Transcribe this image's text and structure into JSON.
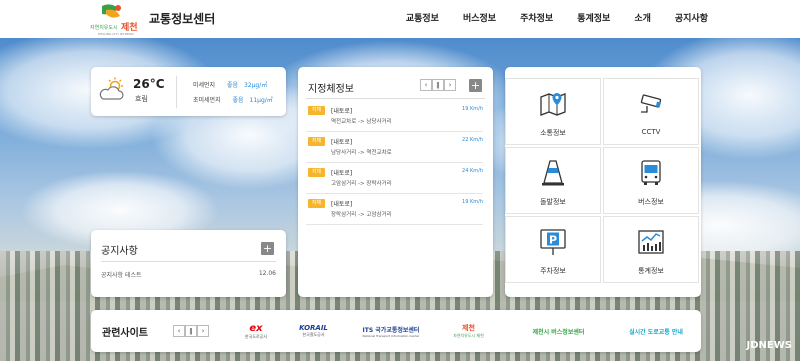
{
  "header": {
    "logo_alt": "자연치유도시 제천",
    "title": "교통정보센터",
    "nav": [
      "교통정보",
      "버스정보",
      "주차정보",
      "통계정보",
      "소개",
      "공지사항"
    ]
  },
  "weather": {
    "temperature": "26°C",
    "sky": "흐림",
    "fine_dust_label": "미세먼지",
    "fine_dust_grade": "좋음",
    "fine_dust_value": "32μg/㎥",
    "ultrafine_dust_label": "초미세먼지",
    "ultrafine_dust_grade": "좋음",
    "ultrafine_dust_value": "11μg/㎥"
  },
  "notice": {
    "title": "공지사항",
    "items": [
      {
        "text": "공지사항 테스트",
        "date": "12.06"
      }
    ]
  },
  "local": {
    "title": "지정체정보",
    "items": [
      {
        "badge": "지체",
        "road": "[내토로]",
        "route": "역전교차로 -> 남당사거리",
        "speed": "19 Km/h"
      },
      {
        "badge": "지체",
        "road": "[내토로]",
        "route": "남당사거리 -> 역전교차로",
        "speed": "22 Km/h"
      },
      {
        "badge": "지체",
        "road": "[내토로]",
        "route": "고암삼거리 -> 장락사거리",
        "speed": "24 Km/h"
      },
      {
        "badge": "지체",
        "road": "[내토로]",
        "route": "장락삼거리 -> 고암삼거리",
        "speed": "19 Km/h"
      }
    ]
  },
  "services": [
    {
      "label": "소통정보",
      "icon": "map-pin-icon"
    },
    {
      "label": "CCTV",
      "icon": "cctv-camera-icon"
    },
    {
      "label": "돌발정보",
      "icon": "traffic-cone-icon"
    },
    {
      "label": "버스정보",
      "icon": "bus-icon"
    },
    {
      "label": "주차정보",
      "icon": "parking-sign-icon"
    },
    {
      "label": "통계정보",
      "icon": "stats-chart-icon"
    }
  ],
  "related": {
    "title": "관련사이트",
    "sites": [
      {
        "main": "ex",
        "sub": "한국도로공사",
        "color": "#e30613"
      },
      {
        "main": "KORAIL",
        "sub": "한국철도공사",
        "color": "#1c3f94"
      },
      {
        "main": "ITS 국가교통정보센터",
        "sub": "National Transport Information Center",
        "color": "#1c3f94"
      },
      {
        "main": "제천",
        "sub": "자연치유도시 제천",
        "color": "#e8502a"
      },
      {
        "main": "제천시 버스정보센터",
        "sub": "",
        "color": "#3aa04a"
      },
      {
        "main": "실시간 도로교통 안내",
        "sub": "",
        "color": "#1aa6c9"
      }
    ]
  },
  "watermark": "JDNEWS"
}
